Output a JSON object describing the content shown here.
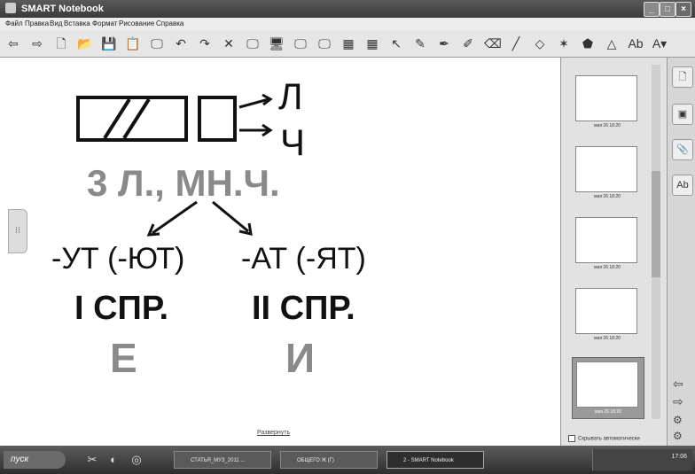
{
  "window": {
    "title": "SMART Notebook",
    "buttons": [
      "_",
      "□",
      "×"
    ]
  },
  "menu": [
    "Файл",
    "Правка",
    "Вид",
    "Вставка",
    "Формат",
    "Рисование",
    "Справка"
  ],
  "toolbar": {
    "icons": [
      "back-icon",
      "forward-icon",
      "page-icon",
      "open-icon",
      "save-icon",
      "paste-icon",
      "screen-icon",
      "undo-icon",
      "redo-icon",
      "delete-icon",
      "screen-shade-icon",
      "display-icon",
      "capture-icon",
      "capture-area-icon",
      "table-icon",
      "insert-table-icon",
      "select-icon",
      "pen-icon",
      "creative-pen-icon",
      "highlighter-icon",
      "eraser-icon",
      "line-icon",
      "shape-icon",
      "magic-pen-icon",
      "fill-icon",
      "triangle-icon",
      "text-icon",
      "font-icon"
    ],
    "glyphs": [
      "⇦",
      "⇨",
      "🗋",
      "📂",
      "💾",
      "📋",
      "🖵",
      "↶",
      "↷",
      "✕",
      "🖵",
      "🖥",
      "🖵",
      "🖵",
      "▦",
      "▦",
      "↖",
      "✎",
      "✒",
      "✐",
      "⌫",
      "╱",
      "◇",
      "✶",
      "⬟",
      "△",
      "Ab",
      "A▾"
    ]
  },
  "page": {
    "labels_right": [
      "Л",
      "Ч"
    ],
    "heading": "3 Л., МН.Ч.",
    "left_ending": "-УТ (-ЮТ)",
    "right_ending": "-АТ (-ЯТ)",
    "left_conj": "I СПР.",
    "right_conj": "II СПР.",
    "left_letter": "Е",
    "right_letter": "И",
    "bottom_link": "Развернуть"
  },
  "sorter": {
    "thumbs": [
      {
        "caption": "мая 26 18:20"
      },
      {
        "caption": "мая 26 18:20"
      },
      {
        "caption": "мая 26 18:20"
      },
      {
        "caption": "мая 26 18:20"
      },
      {
        "caption": "мая 26 18:20"
      }
    ],
    "autohide": "Скрывать автоматически"
  },
  "right_tabs": [
    "page-sorter-icon",
    "gallery-icon",
    "attachments-icon",
    "properties-icon"
  ],
  "taskbar": {
    "start": "пуск",
    "tasks": [
      "СТАТЬЯ_МУЗ_2011 ...",
      "ОБЩЕГО Ж (Г)",
      "2 - SMART Notebook"
    ],
    "clock": "17:06"
  }
}
